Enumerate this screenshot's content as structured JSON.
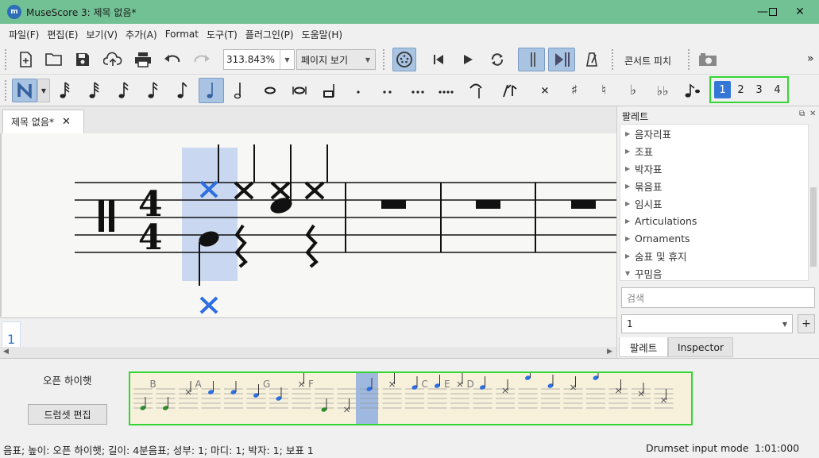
{
  "window": {
    "title": "MuseScore 3: 제목 없음*",
    "app_icon_text": "m"
  },
  "menu": [
    "파일(F)",
    "편집(E)",
    "보기(V)",
    "추가(A)",
    "Format",
    "도구(T)",
    "플러그인(P)",
    "도움말(H)"
  ],
  "toolbar": {
    "zoom_value": "313.843%",
    "view_mode": "페이지 보기",
    "concert_pitch": "콘서트 피치",
    "overflow": "»"
  },
  "voices": [
    "1",
    "2",
    "3",
    "4"
  ],
  "selected_voice": "1",
  "score_tab": {
    "label": "제목 없음*",
    "close": "✕"
  },
  "navigator": {
    "page": "1"
  },
  "palette": {
    "title": "팔레트",
    "items": [
      "음자리표",
      "조표",
      "박자표",
      "묶음표",
      "임시표",
      "Articulations",
      "Ornaments",
      "숨표 및 휴지",
      "꾸밈음"
    ],
    "expanded_item": "꾸밈음",
    "search_placeholder": "검색",
    "workspace_value": "1",
    "plus": "+",
    "tabs": [
      "팔레트",
      "Inspector"
    ]
  },
  "drumset": {
    "selected_instrument": "오픈 하이햇",
    "edit_button": "드럼셋 편집",
    "shortcut_letters": [
      "B",
      "A",
      "G",
      "F",
      "C",
      "E",
      "D"
    ]
  },
  "status": {
    "text": "음표; 높이: 오픈 하이햇; 길이: 4분음표; 성부: 1;  마디: 1; 박자: 1; 보표 1",
    "mode": "Drumset input mode",
    "time": "1:01:000"
  },
  "colors": {
    "titlebar": "#72c195",
    "selection": "#a9c3e2",
    "highlight_border": "#33d633",
    "voice1": "#3477d6"
  }
}
